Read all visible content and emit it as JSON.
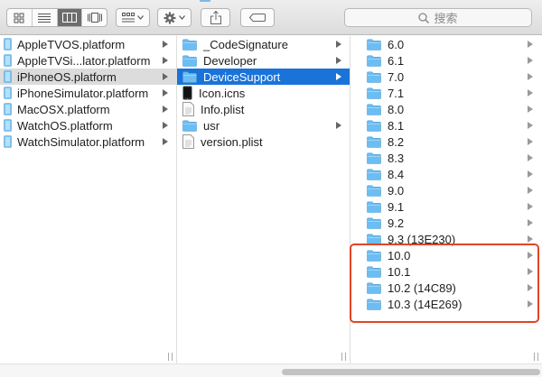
{
  "toolbar": {
    "view_buttons": [
      "icon-view-icon",
      "list-view-icon",
      "column-view-icon",
      "cover-flow-view-icon"
    ],
    "active_view": "column-view-icon",
    "search_placeholder": "搜索"
  },
  "columns": {
    "platforms": [
      {
        "label": "AppleTVOS.platform",
        "selected": false
      },
      {
        "label": "AppleTVSi...lator.platform",
        "selected": false
      },
      {
        "label": "iPhoneOS.platform",
        "selected": true
      },
      {
        "label": "iPhoneSimulator.platform",
        "selected": false
      },
      {
        "label": "MacOSX.platform",
        "selected": false
      },
      {
        "label": "WatchOS.platform",
        "selected": false
      },
      {
        "label": "WatchSimulator.platform",
        "selected": false
      }
    ],
    "contents": [
      {
        "label": "_CodeSignature",
        "icon": "folder-icon",
        "has_children": true,
        "selected": false
      },
      {
        "label": "Developer",
        "icon": "folder-icon",
        "has_children": true,
        "selected": false
      },
      {
        "label": "DeviceSupport",
        "icon": "folder-icon",
        "has_children": true,
        "selected": true
      },
      {
        "label": "Icon.icns",
        "icon": "iphone-icon",
        "has_children": false,
        "selected": false
      },
      {
        "label": "Info.plist",
        "icon": "document-icon",
        "has_children": false,
        "selected": false
      },
      {
        "label": "usr",
        "icon": "folder-icon",
        "has_children": true,
        "selected": false
      },
      {
        "label": "version.plist",
        "icon": "document-icon",
        "has_children": false,
        "selected": false
      }
    ],
    "device_support": [
      {
        "label": "6.0"
      },
      {
        "label": "6.1"
      },
      {
        "label": "7.0"
      },
      {
        "label": "7.1"
      },
      {
        "label": "8.0"
      },
      {
        "label": "8.1"
      },
      {
        "label": "8.2"
      },
      {
        "label": "8.3"
      },
      {
        "label": "8.4"
      },
      {
        "label": "9.0"
      },
      {
        "label": "9.1"
      },
      {
        "label": "9.2"
      },
      {
        "label": "9.3 (13E230)"
      },
      {
        "label": "10.0"
      },
      {
        "label": "10.1"
      },
      {
        "label": "10.2 (14C89)"
      },
      {
        "label": "10.3 (14E269)"
      }
    ]
  },
  "colors": {
    "selection_blue": "#1a73d9",
    "selection_gray": "#dcdcdc",
    "folder_blue": "#6cbdf2",
    "highlight_red": "#e04525"
  }
}
